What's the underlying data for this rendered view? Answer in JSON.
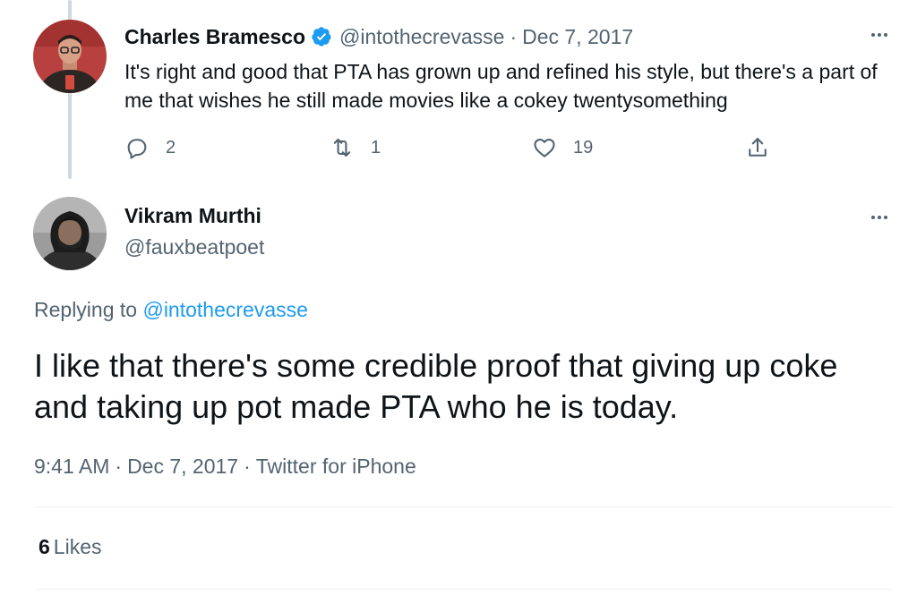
{
  "parent_tweet": {
    "author_name": "Charles Bramesco",
    "author_handle": "@intothecrevasse",
    "date": "Dec 7, 2017",
    "separator": "·",
    "text": "It's right and good that PTA has grown up and refined his style, but there's a part of me that wishes he still made movies like a cokey twentysomething",
    "avatar_icon": "avatar-photo",
    "verified_icon": "verified-badge-icon",
    "more_icon": "more-options-icon",
    "actions": {
      "reply_count": "2",
      "retweet_count": "1",
      "like_count": "19"
    }
  },
  "main_tweet": {
    "author_name": "Vikram Murthi",
    "author_handle": "@fauxbeatpoet",
    "replying_prefix": "Replying to",
    "replying_handle": "@intothecrevasse",
    "text": "I like that there's some credible proof that giving up coke and taking up pot made PTA who he is today.",
    "time": "9:41 AM",
    "date": "Dec 7, 2017",
    "source": "Twitter for iPhone",
    "separator": "·",
    "likes_count": "6",
    "likes_label": "Likes"
  },
  "colors": {
    "text_primary": "#0f1419",
    "text_secondary": "#536471",
    "accent": "#1d9bf0",
    "thread_line": "#cfd9de",
    "divider": "#eff3f4"
  }
}
